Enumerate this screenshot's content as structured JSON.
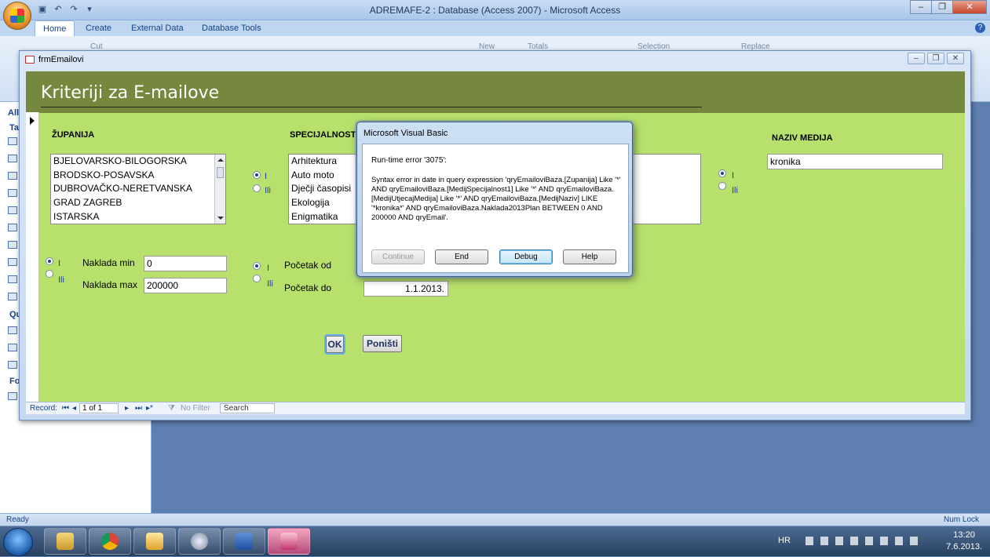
{
  "app": {
    "title": "ADREMAFE-2 : Database (Access 2007) - Microsoft Access",
    "tabs": [
      "Home",
      "Create",
      "External Data",
      "Database Tools"
    ],
    "ribbon_faint": [
      "Cut",
      "New",
      "Totals",
      "Selection",
      "Replace"
    ],
    "status_left": "Ready",
    "status_right": "Num Lock"
  },
  "nav_pane": {
    "headers": [
      "All",
      "Ta",
      "Qu",
      "Fo"
    ]
  },
  "form": {
    "window_title": "frmEmailovi",
    "header_title": "Kriteriji za E-mailove",
    "zupanija": {
      "label": "ŽUPANIJA",
      "items": [
        "BJELOVARSKO-BILOGORSKA",
        "BRODSKO-POSAVSKA",
        "DUBROVAČKO-NERETVANSKA",
        "GRAD ZAGREB",
        "ISTARSKA"
      ]
    },
    "specijalnost": {
      "label": "SPECIJALNOST",
      "items": [
        "Arhitektura",
        "Auto moto",
        "Dječji časopisi",
        "Ekologija",
        "Enigmatika"
      ]
    },
    "naziv_medija": {
      "label": "NAZIV MEDIJA",
      "value": "kronika"
    },
    "radio_i": "I",
    "radio_ili": "Ili",
    "naklada_min": {
      "label": "Naklada min",
      "value": "0"
    },
    "naklada_max": {
      "label": "Naklada max",
      "value": "200000"
    },
    "pocetak_od": {
      "label": "Početak od",
      "value": ""
    },
    "pocetak_do": {
      "label": "Početak do",
      "value": "1.1.2013."
    },
    "ok_label": "OK",
    "cancel_label": "Poništi",
    "record_nav": {
      "record_label": "Record:",
      "position": "1 of 1",
      "no_filter": "No Filter",
      "search": "Search"
    }
  },
  "dialog": {
    "title": "Microsoft Visual Basic",
    "error_code": "Run-time error '3075':",
    "message": "Syntax error in date in query expression 'qryEmailoviBaza.[Zupanija] Like '*' AND qryEmailoviBaza.[MedijSpecijalnost1] Like '*' AND qryEmailoviBaza.[MedijUtjecajMedija] Like '*' AND qryEmailoviBaza.[MedijNaziv] LIKE '*kronika*' AND qryEmailoviBaza.Naklada2013Plan BETWEEN 0 AND 200000 AND qryEmail'.",
    "buttons": {
      "continue": "Continue",
      "end": "End",
      "debug": "Debug",
      "help": "Help"
    }
  },
  "taskbar": {
    "language": "HR",
    "time": "13:20",
    "date": "7.6.2013."
  }
}
